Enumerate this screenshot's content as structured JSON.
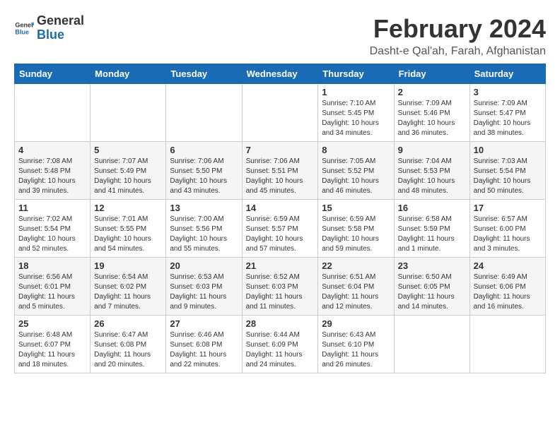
{
  "logo": {
    "text_general": "General",
    "text_blue": "Blue"
  },
  "header": {
    "title": "February 2024",
    "subtitle": "Dasht-e Qal'ah, Farah, Afghanistan"
  },
  "weekdays": [
    "Sunday",
    "Monday",
    "Tuesday",
    "Wednesday",
    "Thursday",
    "Friday",
    "Saturday"
  ],
  "weeks": [
    [
      {
        "day": "",
        "sunrise": "",
        "sunset": "",
        "daylight": ""
      },
      {
        "day": "",
        "sunrise": "",
        "sunset": "",
        "daylight": ""
      },
      {
        "day": "",
        "sunrise": "",
        "sunset": "",
        "daylight": ""
      },
      {
        "day": "",
        "sunrise": "",
        "sunset": "",
        "daylight": ""
      },
      {
        "day": "1",
        "sunrise": "Sunrise: 7:10 AM",
        "sunset": "Sunset: 5:45 PM",
        "daylight": "Daylight: 10 hours and 34 minutes."
      },
      {
        "day": "2",
        "sunrise": "Sunrise: 7:09 AM",
        "sunset": "Sunset: 5:46 PM",
        "daylight": "Daylight: 10 hours and 36 minutes."
      },
      {
        "day": "3",
        "sunrise": "Sunrise: 7:09 AM",
        "sunset": "Sunset: 5:47 PM",
        "daylight": "Daylight: 10 hours and 38 minutes."
      }
    ],
    [
      {
        "day": "4",
        "sunrise": "Sunrise: 7:08 AM",
        "sunset": "Sunset: 5:48 PM",
        "daylight": "Daylight: 10 hours and 39 minutes."
      },
      {
        "day": "5",
        "sunrise": "Sunrise: 7:07 AM",
        "sunset": "Sunset: 5:49 PM",
        "daylight": "Daylight: 10 hours and 41 minutes."
      },
      {
        "day": "6",
        "sunrise": "Sunrise: 7:06 AM",
        "sunset": "Sunset: 5:50 PM",
        "daylight": "Daylight: 10 hours and 43 minutes."
      },
      {
        "day": "7",
        "sunrise": "Sunrise: 7:06 AM",
        "sunset": "Sunset: 5:51 PM",
        "daylight": "Daylight: 10 hours and 45 minutes."
      },
      {
        "day": "8",
        "sunrise": "Sunrise: 7:05 AM",
        "sunset": "Sunset: 5:52 PM",
        "daylight": "Daylight: 10 hours and 46 minutes."
      },
      {
        "day": "9",
        "sunrise": "Sunrise: 7:04 AM",
        "sunset": "Sunset: 5:53 PM",
        "daylight": "Daylight: 10 hours and 48 minutes."
      },
      {
        "day": "10",
        "sunrise": "Sunrise: 7:03 AM",
        "sunset": "Sunset: 5:54 PM",
        "daylight": "Daylight: 10 hours and 50 minutes."
      }
    ],
    [
      {
        "day": "11",
        "sunrise": "Sunrise: 7:02 AM",
        "sunset": "Sunset: 5:54 PM",
        "daylight": "Daylight: 10 hours and 52 minutes."
      },
      {
        "day": "12",
        "sunrise": "Sunrise: 7:01 AM",
        "sunset": "Sunset: 5:55 PM",
        "daylight": "Daylight: 10 hours and 54 minutes."
      },
      {
        "day": "13",
        "sunrise": "Sunrise: 7:00 AM",
        "sunset": "Sunset: 5:56 PM",
        "daylight": "Daylight: 10 hours and 55 minutes."
      },
      {
        "day": "14",
        "sunrise": "Sunrise: 6:59 AM",
        "sunset": "Sunset: 5:57 PM",
        "daylight": "Daylight: 10 hours and 57 minutes."
      },
      {
        "day": "15",
        "sunrise": "Sunrise: 6:59 AM",
        "sunset": "Sunset: 5:58 PM",
        "daylight": "Daylight: 10 hours and 59 minutes."
      },
      {
        "day": "16",
        "sunrise": "Sunrise: 6:58 AM",
        "sunset": "Sunset: 5:59 PM",
        "daylight": "Daylight: 11 hours and 1 minute."
      },
      {
        "day": "17",
        "sunrise": "Sunrise: 6:57 AM",
        "sunset": "Sunset: 6:00 PM",
        "daylight": "Daylight: 11 hours and 3 minutes."
      }
    ],
    [
      {
        "day": "18",
        "sunrise": "Sunrise: 6:56 AM",
        "sunset": "Sunset: 6:01 PM",
        "daylight": "Daylight: 11 hours and 5 minutes."
      },
      {
        "day": "19",
        "sunrise": "Sunrise: 6:54 AM",
        "sunset": "Sunset: 6:02 PM",
        "daylight": "Daylight: 11 hours and 7 minutes."
      },
      {
        "day": "20",
        "sunrise": "Sunrise: 6:53 AM",
        "sunset": "Sunset: 6:03 PM",
        "daylight": "Daylight: 11 hours and 9 minutes."
      },
      {
        "day": "21",
        "sunrise": "Sunrise: 6:52 AM",
        "sunset": "Sunset: 6:03 PM",
        "daylight": "Daylight: 11 hours and 11 minutes."
      },
      {
        "day": "22",
        "sunrise": "Sunrise: 6:51 AM",
        "sunset": "Sunset: 6:04 PM",
        "daylight": "Daylight: 11 hours and 12 minutes."
      },
      {
        "day": "23",
        "sunrise": "Sunrise: 6:50 AM",
        "sunset": "Sunset: 6:05 PM",
        "daylight": "Daylight: 11 hours and 14 minutes."
      },
      {
        "day": "24",
        "sunrise": "Sunrise: 6:49 AM",
        "sunset": "Sunset: 6:06 PM",
        "daylight": "Daylight: 11 hours and 16 minutes."
      }
    ],
    [
      {
        "day": "25",
        "sunrise": "Sunrise: 6:48 AM",
        "sunset": "Sunset: 6:07 PM",
        "daylight": "Daylight: 11 hours and 18 minutes."
      },
      {
        "day": "26",
        "sunrise": "Sunrise: 6:47 AM",
        "sunset": "Sunset: 6:08 PM",
        "daylight": "Daylight: 11 hours and 20 minutes."
      },
      {
        "day": "27",
        "sunrise": "Sunrise: 6:46 AM",
        "sunset": "Sunset: 6:08 PM",
        "daylight": "Daylight: 11 hours and 22 minutes."
      },
      {
        "day": "28",
        "sunrise": "Sunrise: 6:44 AM",
        "sunset": "Sunset: 6:09 PM",
        "daylight": "Daylight: 11 hours and 24 minutes."
      },
      {
        "day": "29",
        "sunrise": "Sunrise: 6:43 AM",
        "sunset": "Sunset: 6:10 PM",
        "daylight": "Daylight: 11 hours and 26 minutes."
      },
      {
        "day": "",
        "sunrise": "",
        "sunset": "",
        "daylight": ""
      },
      {
        "day": "",
        "sunrise": "",
        "sunset": "",
        "daylight": ""
      }
    ]
  ]
}
